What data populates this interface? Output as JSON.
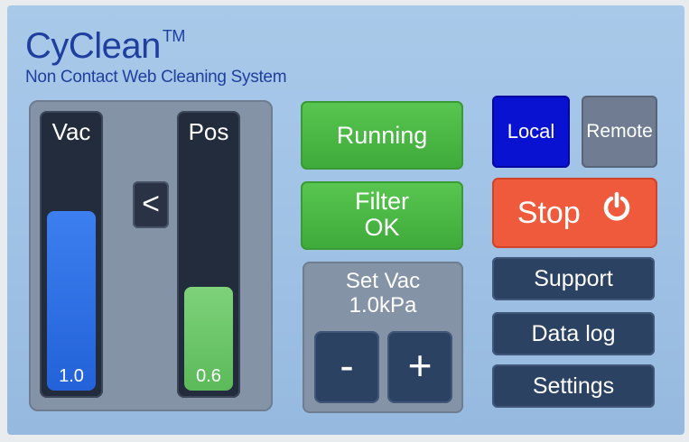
{
  "brand": {
    "name": "CyClean",
    "trademark": "TM",
    "subtitle": "Non Contact Web Cleaning System"
  },
  "gauges": {
    "vac": {
      "label": "Vac",
      "value": "1.0",
      "level": 0.66,
      "color": "#2f72e6"
    },
    "pos": {
      "label": "Pos",
      "value": "0.6",
      "level": 0.38,
      "color": "#6cc66a"
    },
    "comparison": "<"
  },
  "status": {
    "running": "Running",
    "filter_line1": "Filter",
    "filter_line2": "OK"
  },
  "set_vac": {
    "title_line1": "Set Vac",
    "title_line2": "1.0kPa",
    "minus": "-",
    "plus": "+"
  },
  "mode": {
    "local": "Local",
    "remote": "Remote",
    "active": "local"
  },
  "controls": {
    "stop": "Stop",
    "stop_icon": "power-icon",
    "support": "Support",
    "data_log": "Data log",
    "settings": "Settings"
  },
  "colors": {
    "background": "#a4c6e8",
    "brand": "#1e3f9e",
    "green": "#4cb846",
    "stop": "#ef5a3d",
    "local_active": "#0a12d2",
    "navy_button": "#2c4263"
  }
}
